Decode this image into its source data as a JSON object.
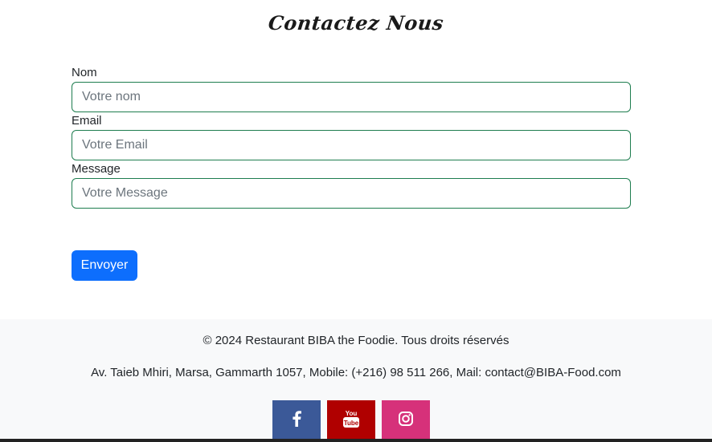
{
  "page": {
    "title": "Contactez Nous"
  },
  "form": {
    "name_label": "Nom",
    "name_placeholder": "Votre nom",
    "email_label": "Email",
    "email_placeholder": "Votre Email",
    "message_label": "Message",
    "message_placeholder": "Votre Message",
    "submit_label": "Envoyer"
  },
  "footer": {
    "copyright": "© 2024 Restaurant BIBA the Foodie. Tous droits réservés",
    "address": "Av. Taieb Mhiri, Marsa, Gammarth 1057, Mobile: (+216) 98 511 266, Mail: contact@BIBA-Food.com",
    "socials": [
      {
        "name": "facebook",
        "icon": "facebook-icon",
        "color": "#3b5998"
      },
      {
        "name": "youtube",
        "icon": "youtube-icon",
        "color": "#b00000"
      },
      {
        "name": "instagram",
        "icon": "instagram-icon",
        "color": "#d6317a"
      }
    ]
  },
  "colors": {
    "primary_button": "#0d6efd",
    "input_border": "#1e7d4f",
    "footer_bg": "#f8f9fa"
  }
}
